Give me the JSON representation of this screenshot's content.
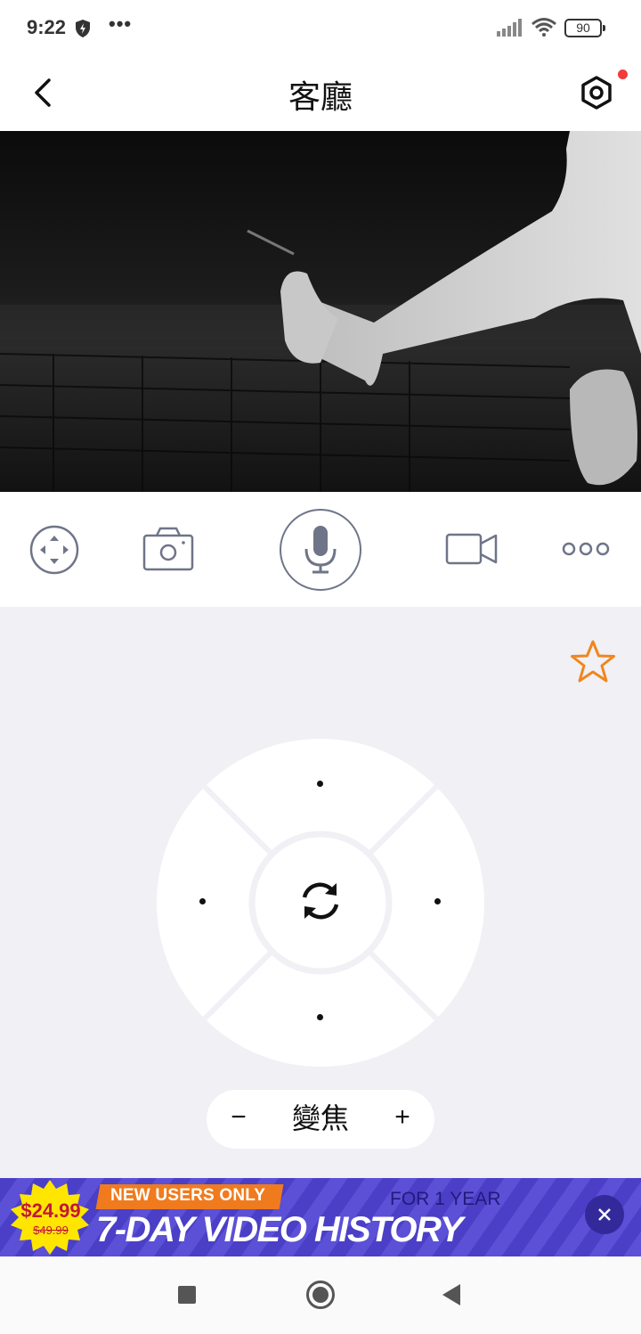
{
  "status_bar": {
    "time": "9:22",
    "more": "•••",
    "battery": "90"
  },
  "header": {
    "title": "客廳",
    "back_icon": "chevron-left-icon",
    "settings_icon": "hexagon-settings-icon",
    "notification_color": "#f23b3b"
  },
  "video": {
    "icon": "live-camera-feed"
  },
  "toolbar": {
    "items": [
      {
        "icon": "pan-tilt-icon"
      },
      {
        "icon": "camera-snapshot-icon"
      },
      {
        "icon": "microphone-icon"
      },
      {
        "icon": "video-record-icon"
      },
      {
        "icon": "more-options-icon"
      }
    ]
  },
  "controls": {
    "favorite_icon": "star-outline-icon",
    "favorite_color": "#f0861e",
    "dpad_center_icon": "rotate-refresh-icon",
    "zoom": {
      "minus": "−",
      "label": "變焦",
      "plus": "+"
    }
  },
  "promo": {
    "price": "$24.99",
    "old_price": "$49.99",
    "tag": "NEW USERS ONLY",
    "subtitle": "FOR 1 YEAR",
    "headline": "7-DAY VIDEO HISTORY",
    "close_icon": "close-icon",
    "background_color": "#4a3fc6",
    "accent_color": "#f07b1e",
    "badge_color": "#ffe600"
  },
  "nav_bar": {
    "recent_icon": "recent-apps-icon",
    "home_icon": "home-icon",
    "back_icon": "back-triangle-icon"
  }
}
